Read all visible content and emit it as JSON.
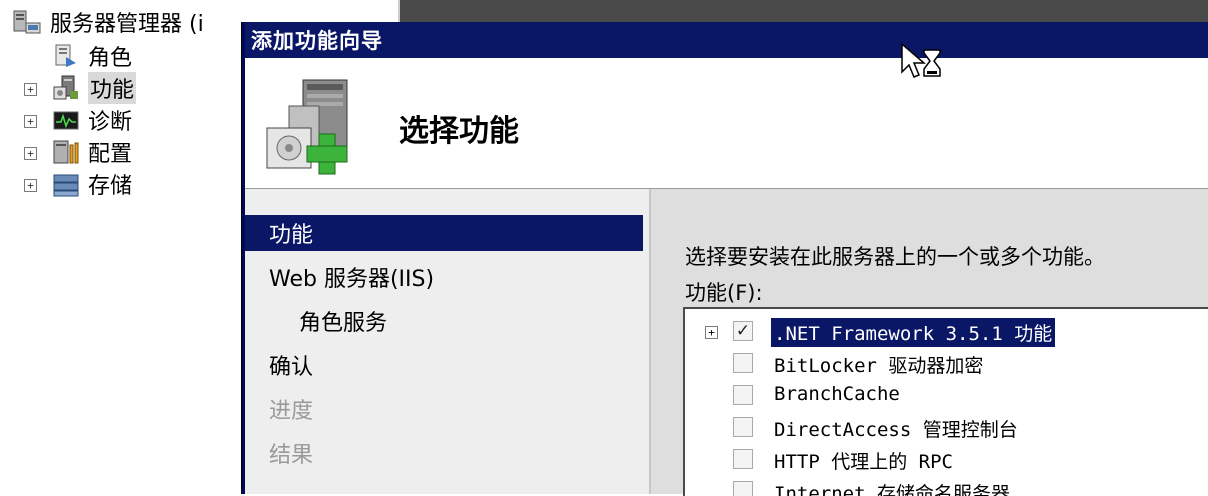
{
  "tree": {
    "root": "服务器管理器 (i",
    "nodes": [
      {
        "label": "角色",
        "icon": "roles-icon",
        "expander": false
      },
      {
        "label": "功能",
        "icon": "features-icon",
        "expander": true,
        "selected": true
      },
      {
        "label": "诊断",
        "icon": "diagnostics-icon",
        "expander": true
      },
      {
        "label": "配置",
        "icon": "configuration-icon",
        "expander": true
      },
      {
        "label": "存储",
        "icon": "storage-icon",
        "expander": true
      }
    ]
  },
  "wizard": {
    "title": "添加功能向导",
    "header_title": "选择功能",
    "nav": [
      {
        "label": "功能",
        "state": "active"
      },
      {
        "label": "Web 服务器(IIS)",
        "state": "normal"
      },
      {
        "label": "角色服务",
        "state": "sub"
      },
      {
        "label": "确认",
        "state": "normal"
      },
      {
        "label": "进度",
        "state": "disabled"
      },
      {
        "label": "结果",
        "state": "disabled"
      }
    ],
    "instruction": "选择要安装在此服务器上的一个或多个功能。",
    "features_label": "功能(F):",
    "features": [
      {
        "label": ".NET Framework 3.5.1 功能",
        "checked": true,
        "expandable": true,
        "selected": true
      },
      {
        "label": "BitLocker 驱动器加密",
        "checked": false
      },
      {
        "label": "BranchCache",
        "checked": false
      },
      {
        "label": "DirectAccess 管理控制台",
        "checked": false
      },
      {
        "label": "HTTP 代理上的 RPC",
        "checked": false
      },
      {
        "label": "Internet 存储命名服务器",
        "checked": false
      }
    ]
  },
  "colors": {
    "titlebar": "#0a1766",
    "nav_bg": "#eeeeee",
    "content_bg": "#dedede"
  }
}
